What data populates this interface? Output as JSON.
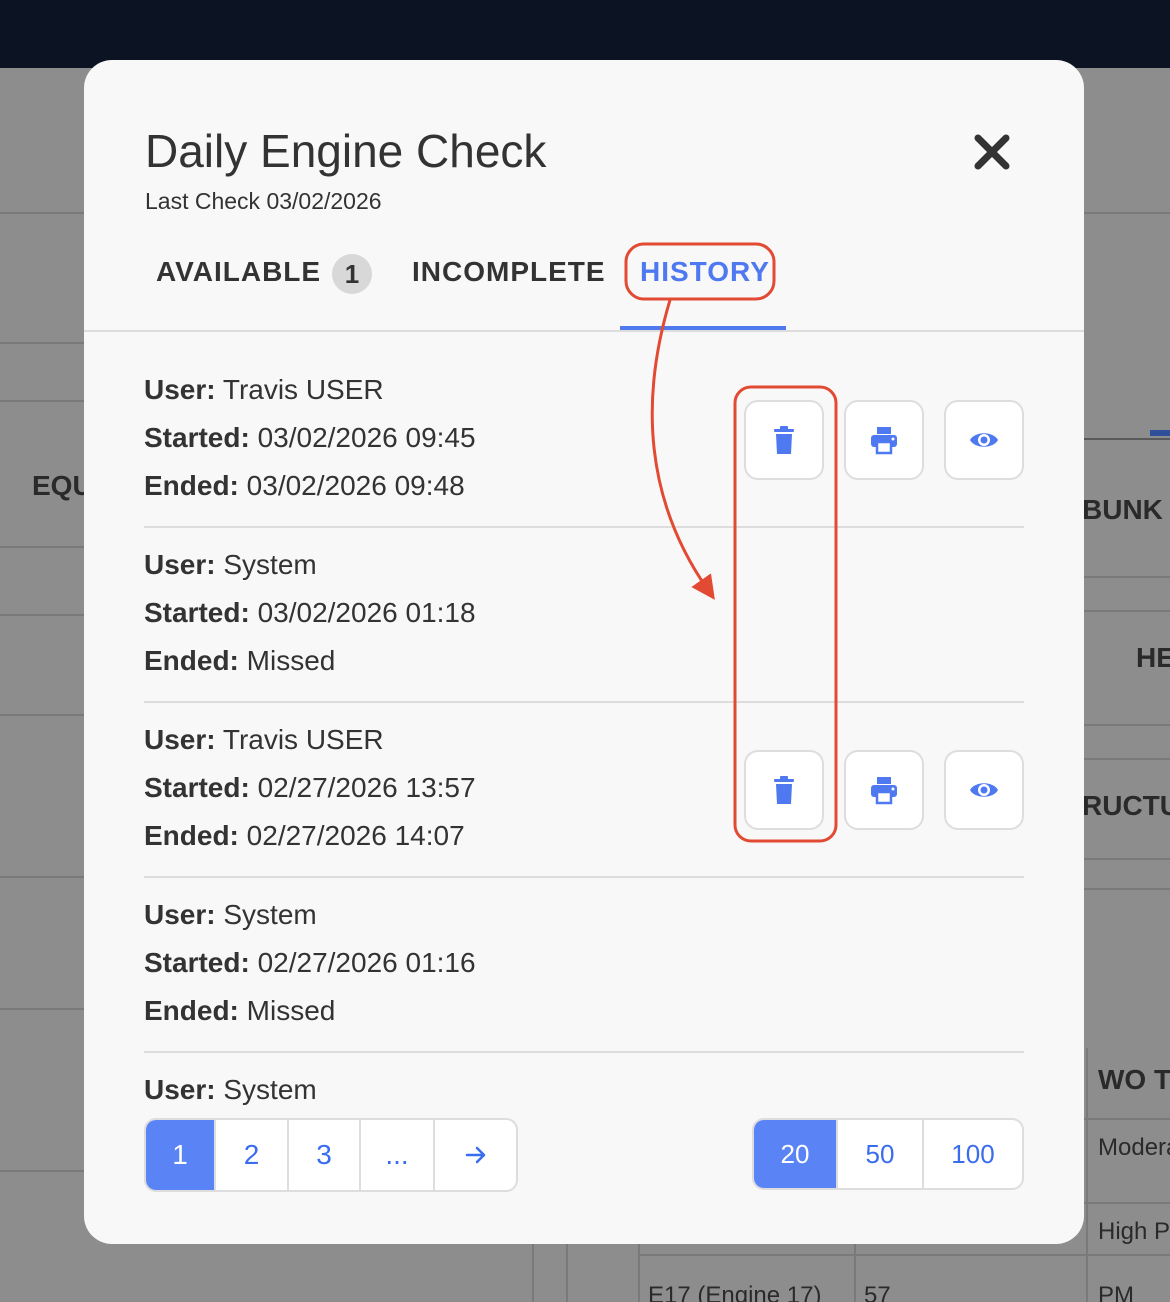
{
  "background": {
    "labels": [
      "EQU",
      "BUNK",
      "HE",
      "RUCTU",
      "WO T",
      "Modera",
      "High Pr",
      "E17 (Engine 17)",
      "57",
      "PM"
    ]
  },
  "modal": {
    "title": "Daily Engine Check",
    "subtitle": "Last Check 03/02/2026",
    "close_icon": "close-icon",
    "tabs": [
      {
        "label": "AVAILABLE",
        "badge": "1"
      },
      {
        "label": "INCOMPLETE"
      },
      {
        "label": "HISTORY",
        "active": true
      }
    ],
    "entries": [
      {
        "user_label": "User:",
        "user": "Travis USER",
        "started_label": "Started:",
        "started": "03/02/2026 09:45",
        "ended_label": "Ended:",
        "ended": "03/02/2026 09:48",
        "actions": [
          "trash-icon",
          "printer-icon",
          "eye-icon"
        ]
      },
      {
        "user_label": "User:",
        "user": "System",
        "started_label": "Started:",
        "started": "03/02/2026 01:18",
        "ended_label": "Ended:",
        "ended": "Missed",
        "actions": []
      },
      {
        "user_label": "User:",
        "user": "Travis USER",
        "started_label": "Started:",
        "started": "02/27/2026 13:57",
        "ended_label": "Ended:",
        "ended": "02/27/2026 14:07",
        "actions": [
          "trash-icon",
          "printer-icon",
          "eye-icon"
        ]
      },
      {
        "user_label": "User:",
        "user": "System",
        "started_label": "Started:",
        "started": "02/27/2026 01:16",
        "ended_label": "Ended:",
        "ended": "Missed",
        "actions": []
      },
      {
        "user_label": "User:",
        "user": "System"
      }
    ],
    "pagination": {
      "pages": [
        "1",
        "2",
        "3",
        "..."
      ],
      "current": "1",
      "next_icon": "arrow-right-icon"
    },
    "page_sizes": {
      "options": [
        "20",
        "50",
        "100"
      ],
      "selected": "20"
    }
  },
  "colors": {
    "accent": "#4e79f0",
    "annotation": "#e24a33",
    "topbar": "#0c1322"
  }
}
